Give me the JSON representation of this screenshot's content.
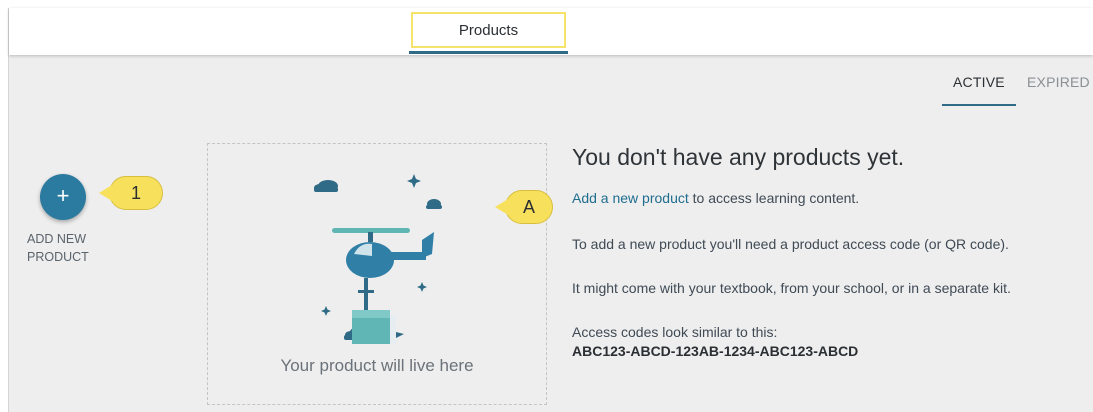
{
  "header": {
    "tab_label": "Products"
  },
  "filters": {
    "active_label": "ACTIVE",
    "expired_label": "EXPIRED"
  },
  "add_product": {
    "button_symbol": "+",
    "label_line1": "ADD NEW",
    "label_line2": "PRODUCT"
  },
  "callouts": {
    "one": "1",
    "a": "A"
  },
  "placeholder": {
    "text": "Your product will live here"
  },
  "empty_state": {
    "title": "You don't have any products yet.",
    "link_text": "Add a new product",
    "link_suffix": " to access learning content.",
    "line2": "To add a new product you'll need a product access code (or QR code).",
    "line3": "It might come with your textbook, from your school, or in a separate kit.",
    "code_label": "Access codes look similar to this:",
    "code_sample": "ABC123-ABCD-123AB-1234-ABC123-ABCD"
  },
  "colors": {
    "accent": "#2b7aa0",
    "highlight": "#f7e15c",
    "link": "#1f6d8f"
  },
  "icons": {
    "add": "plus-icon",
    "illustration": "helicopter-illustration"
  }
}
